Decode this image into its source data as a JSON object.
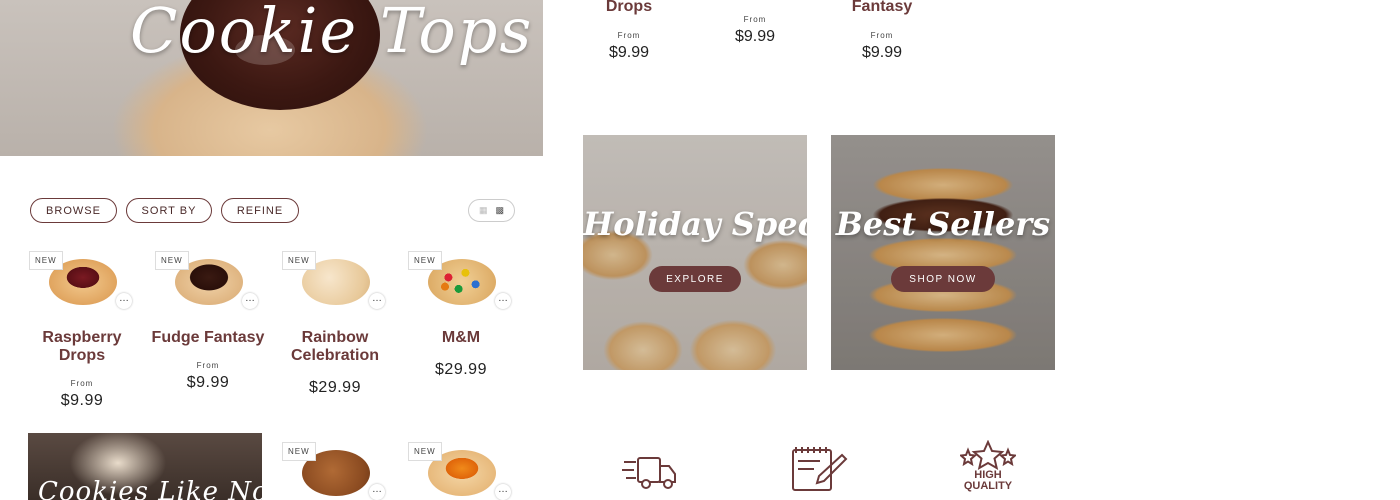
{
  "hero": {
    "title": "Cookie Tops"
  },
  "toolbar": {
    "browse": "BROWSE",
    "sort_by": "SORT BY",
    "refine": "REFINE",
    "view_icons": [
      "grid-small-icon",
      "grid-large-icon"
    ]
  },
  "badge_new": "NEW",
  "more_glyph": "…",
  "top_strip": [
    {
      "name": "Drops",
      "from": "From",
      "price": "$9.99"
    },
    {
      "name": "",
      "from": "From",
      "price": "$9.99"
    },
    {
      "name": "Fantasy",
      "from": "From",
      "price": "$9.99"
    }
  ],
  "products": [
    {
      "name": "Raspberry Drops",
      "from": "From",
      "price": "$9.99",
      "badge": "NEW"
    },
    {
      "name": "Fudge Fantasy",
      "from": "From",
      "price": "$9.99",
      "badge": "NEW"
    },
    {
      "name": "Rainbow Celebration",
      "from": "",
      "price": "$29.99",
      "badge": "NEW"
    },
    {
      "name": "M&M",
      "from": "",
      "price": "$29.99",
      "badge": "NEW"
    }
  ],
  "row2": [
    {
      "badge": "NEW"
    },
    {
      "badge": "NEW"
    }
  ],
  "banner_bottom": {
    "title": "Cookies Like No Other"
  },
  "promos": [
    {
      "title": "Holiday Specials",
      "button": "EXPLORE"
    },
    {
      "title": "Best Sellers",
      "button": "SHOP NOW"
    }
  ],
  "features": [
    {
      "icon": "delivery-truck-icon"
    },
    {
      "icon": "calendar-edit-icon"
    },
    {
      "icon": "high-quality-badge-icon",
      "label_line1": "HIGH",
      "label_line2": "QUALITY"
    }
  ],
  "colors": {
    "brand": "#6b3a3a",
    "text": "#222222",
    "white": "#ffffff"
  }
}
